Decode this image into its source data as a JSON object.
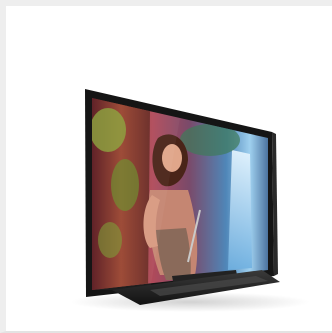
{
  "image": {
    "subject": "tv-product-photo",
    "colors": {
      "background": "#ffffff",
      "frame": "#eeeeee",
      "bezel": "#151515",
      "stand": "#1c1c1c",
      "screen_left": "#7a2b35",
      "screen_right": "#5a9fd0"
    }
  }
}
